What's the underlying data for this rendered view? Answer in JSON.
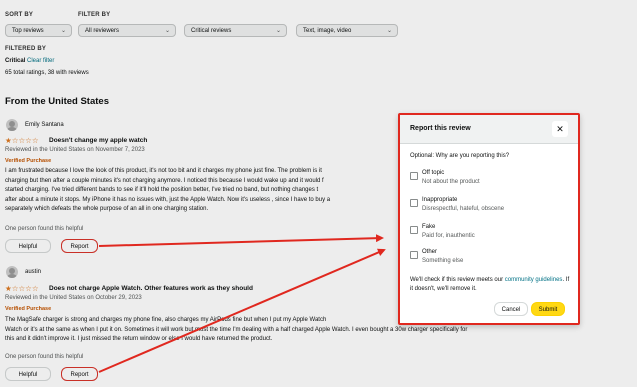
{
  "filters": {
    "sort_label": "SORT BY",
    "filter_label": "FILTER BY",
    "sort_value": "Top reviews",
    "reviewers_value": "All reviewers",
    "rating_value": "Critical reviews",
    "media_value": "Text, image, video"
  },
  "filtered": {
    "label": "FILTERED BY",
    "value": "Critical",
    "clear": "Clear filter",
    "count": "65 total ratings, 38 with reviews"
  },
  "section_title": "From the United States",
  "reviews": [
    {
      "author": "Emily Santana",
      "stars": "★☆☆☆☆",
      "title": "Doesn't change my apple watch",
      "meta": "Reviewed in the United States on November 7, 2023",
      "verified": "Verified Purchase",
      "body": [
        "I am frustrated because I love the look of this product, it's not too bit and it charges my phone just fine. The problem is it",
        "charging but then after a couple minutes it's not charging anymore. I noticed this because I would wake up and it would f",
        "started charging. I've tried different bands to see if it'll hold the position better, I've tried no band, but nothing changes t",
        "after about a minute it stops. My iPhone it has no issues with, just the Apple Watch. Now it's useless , since I have to buy a",
        "separately which defeats the whole purpose of an all in one charging station."
      ],
      "helpful_text": "One person found this helpful",
      "helpful_button": "Helpful",
      "report_button": "Report"
    },
    {
      "author": "austin",
      "stars": "★☆☆☆☆",
      "title": "Does not charge Apple Watch. Other features work as they should",
      "meta": "Reviewed in the United States on October 29, 2023",
      "verified": "Verified Purchase",
      "body": [
        "The MagSafe charger is strong and charges my phone fine, also charges my AirPods fine but when I put my Apple Watch",
        "Watch or it's at the same as when I put it on. Sometimes it will work but most the time I'm dealing with a half charged Apple Watch. I even bought a 30w charger specifically for",
        "this and it didn't improve it. I just missed the return window or else I would have returned the product."
      ],
      "helpful_text": "One person found this helpful",
      "helpful_button": "Helpful",
      "report_button": "Report"
    }
  ],
  "modal": {
    "title": "Report this review",
    "close": "✕",
    "question": "Optional: Why are you reporting this?",
    "options": [
      {
        "title": "Off topic",
        "desc": "Not about the product"
      },
      {
        "title": "Inappropriate",
        "desc": "Disrespectful, hateful, obscene"
      },
      {
        "title": "Fake",
        "desc": "Paid for, inauthentic"
      },
      {
        "title": "Other",
        "desc": "Something else"
      }
    ],
    "note_before": "We'll check if this review meets our ",
    "note_link": "community guidelines",
    "note_after": ". If it doesn't, we'll remove it.",
    "cancel": "Cancel",
    "submit": "Submit"
  },
  "colors": {
    "accent_link": "#007185",
    "star": "#de7921",
    "verified": "#c45500",
    "annotation_red": "#e0281f",
    "submit_bg": "#ffd814"
  }
}
